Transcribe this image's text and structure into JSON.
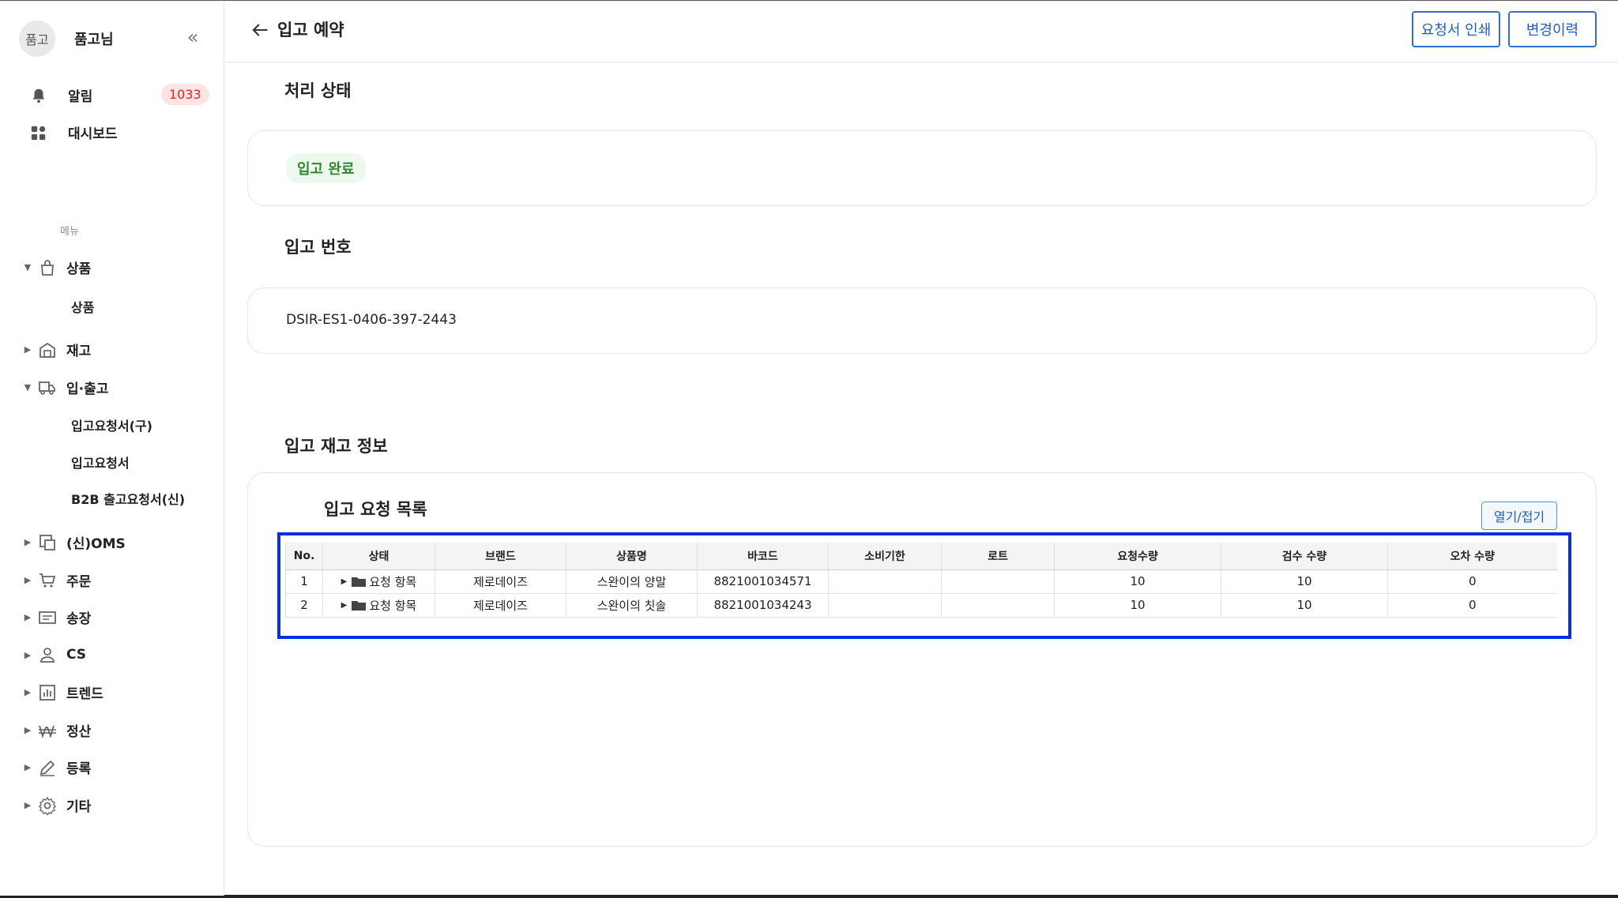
{
  "user": {
    "avatar_text": "품고",
    "name": "품고님"
  },
  "sidebar": {
    "top_items": [
      {
        "label": "알림",
        "icon": "bell-icon",
        "badge": "1033"
      },
      {
        "label": "대시보드",
        "icon": "dashboard-icon"
      }
    ],
    "menu_header": "메뉴",
    "nav": [
      {
        "label": "상품",
        "icon": "bag-icon",
        "expanded": true,
        "children": [
          "상품"
        ]
      },
      {
        "label": "재고",
        "icon": "warehouse-icon",
        "expanded": false
      },
      {
        "label": "입·출고",
        "icon": "truck-icon",
        "expanded": true,
        "children": [
          "입고요청서(구)",
          "입고요청서",
          "B2B 출고요청서(신)"
        ]
      },
      {
        "label": "(신)OMS",
        "icon": "oms-icon",
        "expanded": false
      },
      {
        "label": "주문",
        "icon": "cart-icon",
        "expanded": false
      },
      {
        "label": "송장",
        "icon": "invoice-icon",
        "expanded": false
      },
      {
        "label": "CS",
        "icon": "person-icon",
        "expanded": false
      },
      {
        "label": "트렌드",
        "icon": "chart-icon",
        "expanded": false
      },
      {
        "label": "정산",
        "icon": "won-icon",
        "expanded": false
      },
      {
        "label": "등록",
        "icon": "pencil-icon",
        "expanded": false
      },
      {
        "label": "기타",
        "icon": "gear-icon",
        "expanded": false
      }
    ]
  },
  "header": {
    "title": "입고 예약",
    "print_label": "요청서 인쇄",
    "history_label": "변경이력"
  },
  "sections": {
    "status_title": "처리 상태",
    "status_value": "입고 완료",
    "number_title": "입고 번호",
    "number_value": "DSIR-ES1-0406-397-2443",
    "stock_title": "입고 재고 정보",
    "list_title": "입고 요청 목록",
    "toggle_label": "열기/접기"
  },
  "table": {
    "columns": [
      "No.",
      "상태",
      "브랜드",
      "상품명",
      "바코드",
      "소비기한",
      "로트",
      "요청수량",
      "검수 수량",
      "오차 수량"
    ],
    "rows": [
      {
        "no": "1",
        "status": "요청 항목",
        "brand": "제로데이즈",
        "product": "스완이의 양말",
        "barcode": "8821001034571",
        "expiry": "",
        "lot": "",
        "requested": "10",
        "inspected": "10",
        "diff": "0"
      },
      {
        "no": "2",
        "status": "요청 항목",
        "brand": "제로데이즈",
        "product": "스완이의 칫솔",
        "barcode": "8821001034243",
        "expiry": "",
        "lot": "",
        "requested": "10",
        "inspected": "10",
        "diff": "0"
      }
    ]
  },
  "colors": {
    "accent": "#1f5fc4",
    "highlight": "#0a2fe0",
    "badge": "#e02424",
    "status_green": "#2e8b2e"
  }
}
